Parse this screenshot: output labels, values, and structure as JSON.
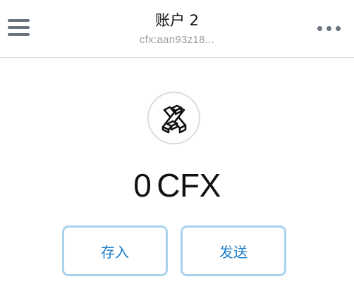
{
  "header": {
    "account_name": "账户 2",
    "account_address": "cfx:aan93z18...",
    "menu_icon": "hamburger-menu-icon",
    "more_icon": "more-options-icon"
  },
  "wallet": {
    "identicon_icon": "account-identicon-icon",
    "balance_value": "0",
    "balance_unit": "CFX"
  },
  "actions": {
    "deposit_label": "存入",
    "send_label": "发送"
  },
  "colors": {
    "accent": "#1c7ec9",
    "button_border": "#a9d2ec",
    "icon_gray": "#6a737d",
    "address_gray": "#9a9ea3"
  }
}
